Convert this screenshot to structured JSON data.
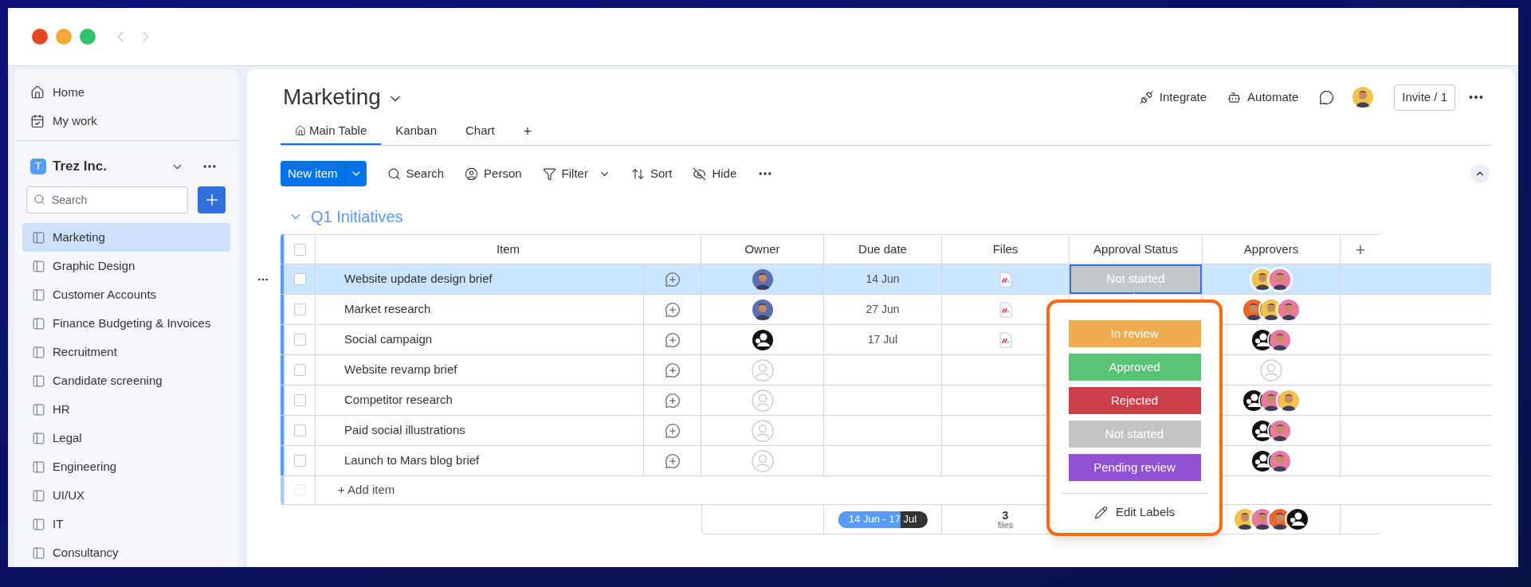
{
  "sidebar": {
    "nav": [
      {
        "label": "Home",
        "kind": "home"
      },
      {
        "label": "My work",
        "kind": "calendar"
      }
    ],
    "workspace": {
      "initial": "T",
      "name": "Trez Inc."
    },
    "search": {
      "placeholder": "Search"
    },
    "boards": [
      {
        "label": "Marketing",
        "selected": true
      },
      {
        "label": "Graphic Design",
        "selected": false
      },
      {
        "label": "Customer Accounts",
        "selected": false
      },
      {
        "label": "Finance Budgeting & Invoices",
        "selected": false
      },
      {
        "label": "Recruitment",
        "selected": false
      },
      {
        "label": "Candidate screening",
        "selected": false
      },
      {
        "label": "HR",
        "selected": false
      },
      {
        "label": "Legal",
        "selected": false
      },
      {
        "label": "Engineering",
        "selected": false
      },
      {
        "label": "UI/UX",
        "selected": false
      },
      {
        "label": "IT",
        "selected": false
      },
      {
        "label": "Consultancy",
        "selected": false
      }
    ]
  },
  "board": {
    "title": "Marketing",
    "actions": [
      {
        "label": "Integrate",
        "kind": "integrate"
      },
      {
        "label": "Automate",
        "kind": "automate"
      }
    ],
    "invite": "Invite / 1",
    "user": {
      "kind": "person",
      "color": "#f2c14e"
    },
    "tabs": [
      {
        "label": "Main Table",
        "selected": true
      },
      {
        "label": "Kanban",
        "selected": false
      },
      {
        "label": "Chart",
        "selected": false
      }
    ],
    "add_tab": "+",
    "new_item": "New item",
    "tools": [
      {
        "label": "Search",
        "kind": "search"
      },
      {
        "label": "Person",
        "kind": "person"
      },
      {
        "label": "Filter",
        "kind": "filter"
      },
      {
        "label": "Sort",
        "kind": "sort"
      },
      {
        "label": "Hide",
        "kind": "hide"
      }
    ]
  },
  "group": {
    "title": "Q1 Initiatives",
    "columns": [
      "Item",
      "Owner",
      "Due date",
      "Files",
      "Approval Status",
      "Approvers"
    ],
    "add_column": "+",
    "rows": [
      {
        "item": "Website update design brief",
        "selected": true,
        "checked": false,
        "owner": {
          "kind": "person",
          "color": "#5b6fb0"
        },
        "due": "14 Jun",
        "file": true,
        "status": {
          "label": "Not started",
          "color": "#c4c7cc"
        },
        "approvers": [
          {
            "kind": "person",
            "color": "#f2c14e"
          },
          {
            "kind": "person",
            "color": "#e87aa0"
          }
        ]
      },
      {
        "item": "Market research",
        "selected": false,
        "checked": false,
        "owner": {
          "kind": "person",
          "color": "#5b6fb0"
        },
        "due": "27 Jun",
        "file": true,
        "approvers": [
          {
            "kind": "person",
            "color": "#e8672c"
          },
          {
            "kind": "person",
            "color": "#f2c14e"
          },
          {
            "kind": "person",
            "color": "#e87aa0"
          }
        ]
      },
      {
        "item": "Social campaign",
        "selected": false,
        "checked": false,
        "owner": {
          "kind": "group"
        },
        "due": "17 Jul",
        "file": true,
        "approvers": [
          {
            "kind": "group"
          },
          {
            "kind": "person",
            "color": "#e87aa0"
          }
        ]
      },
      {
        "item": "Website revamp brief",
        "selected": false,
        "checked": false,
        "owner": {
          "kind": "empty"
        },
        "file": false,
        "approvers": [
          {
            "kind": "empty"
          }
        ]
      },
      {
        "item": "Competitor research",
        "selected": false,
        "checked": false,
        "owner": {
          "kind": "empty"
        },
        "file": false,
        "approvers": [
          {
            "kind": "group"
          },
          {
            "kind": "person",
            "color": "#e87aa0"
          },
          {
            "kind": "person",
            "color": "#f2c14e"
          }
        ]
      },
      {
        "item": "Paid social illustrations",
        "selected": false,
        "checked": false,
        "owner": {
          "kind": "empty"
        },
        "file": false,
        "approvers": [
          {
            "kind": "group"
          },
          {
            "kind": "person",
            "color": "#e87aa0"
          }
        ]
      },
      {
        "item": "Launch to Mars blog brief",
        "selected": false,
        "checked": false,
        "owner": {
          "kind": "empty"
        },
        "file": false,
        "approvers": [
          {
            "kind": "group"
          },
          {
            "kind": "person",
            "color": "#e87aa0"
          }
        ]
      }
    ],
    "select_all": {
      "checked": false
    },
    "add_item": {
      "label": "+ Add item",
      "checked": false
    },
    "summary": {
      "date_range": "14 Jun - 17 Jul",
      "level": 0.7,
      "files_count": "3",
      "files_label": "files",
      "approvers": [
        {
          "kind": "person",
          "color": "#f2c14e"
        },
        {
          "kind": "person",
          "color": "#e87aa0"
        },
        {
          "kind": "person",
          "color": "#e8672c"
        },
        {
          "kind": "group"
        }
      ]
    }
  },
  "status_menu": {
    "options": [
      {
        "label": "In review",
        "color": "#f0ad50"
      },
      {
        "label": "Approved",
        "color": "#57c478"
      },
      {
        "label": "Rejected",
        "color": "#cc3f4a"
      },
      {
        "label": "Not started",
        "color": "#c4c4c4"
      },
      {
        "label": "Pending review",
        "color": "#9151d4"
      }
    ],
    "edit": "Edit Labels"
  }
}
